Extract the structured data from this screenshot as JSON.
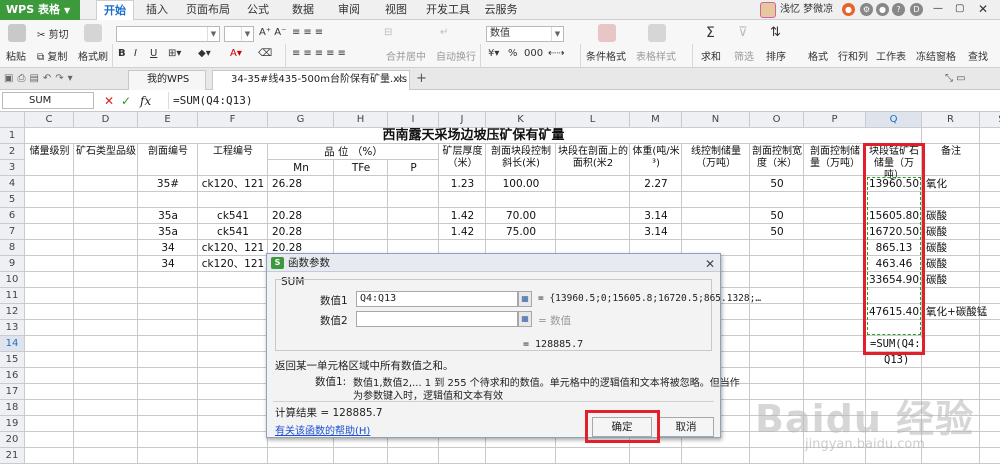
{
  "app": {
    "name": "WPS 表格"
  },
  "menu": {
    "tabs": [
      "开始",
      "插入",
      "页面布局",
      "公式",
      "数据",
      "审阅",
      "视图",
      "开发工具",
      "云服务"
    ],
    "active": "开始"
  },
  "user": {
    "name": "浅忆 梦微凉"
  },
  "ribbon": {
    "cut": "剪切",
    "paste": "粘贴",
    "copy": "复制",
    "format_painter": "格式刷",
    "merge_center": "合并居中",
    "auto_wrap": "自动换行",
    "number_format": "数值",
    "cond_format": "条件格式",
    "table_style": "表格样式",
    "sum": "求和",
    "filter": "筛选",
    "sort": "排序",
    "format": "格式",
    "rowcol": "行和列",
    "sheet": "工作表",
    "freeze": "冻结窗格",
    "find": "查找",
    "percent": "%",
    "thousand": "000"
  },
  "doc_tabs": {
    "home": "我的WPS",
    "file": "34-35#线435-500m台阶保有矿量.xls"
  },
  "formula_bar": {
    "name_box": "SUM",
    "formula": "=SUM(Q4:Q13)"
  },
  "title": "西南露天采场边坡压矿保有矿量",
  "columns": [
    "C",
    "D",
    "E",
    "F",
    "G",
    "H",
    "I",
    "J",
    "K",
    "L",
    "M",
    "N",
    "O",
    "P",
    "Q",
    "R",
    "S"
  ],
  "rows": [
    "1",
    "2",
    "3",
    "4",
    "5",
    "6",
    "7",
    "8",
    "9",
    "10",
    "11",
    "12",
    "13",
    "14",
    "15",
    "16",
    "17",
    "18",
    "19",
    "20",
    "21"
  ],
  "headers": {
    "reserve_level": "储量级别",
    "ore_type": "矿石类型品级",
    "section_no": "剖面编号",
    "project_no": "工程编号",
    "grade": "品 位 （%）",
    "mn": "Mn",
    "tfe": "TFe",
    "p": "P",
    "thickness": "矿层厚度（米）",
    "control_len": "剖面块段控制斜长(米)",
    "area": "块段在剖面上的面积(米2",
    "density": "体重(吨/米³)",
    "line_reserve": "线控制储量（万吨）",
    "section_width": "剖面控制宽度（米）",
    "section_reserve": "剖面控制储量（万吨）",
    "block_reserve": "块段锰矿石储量（万吨）",
    "remark": "备注"
  },
  "data_rows": [
    {
      "row": "4",
      "e": "35#",
      "f": "ck120、121",
      "g": "26.28",
      "j": "1.23",
      "k": "100.00",
      "m": "2.27",
      "o": "50",
      "q": "13960.50",
      "r": "氧化"
    },
    {
      "row": "5",
      "e": "",
      "f": "",
      "g": "",
      "j": "",
      "k": "",
      "m": "",
      "o": "",
      "q": "",
      "r": ""
    },
    {
      "row": "6",
      "e": "35a",
      "f": "ck541",
      "g": "20.28",
      "j": "1.42",
      "k": "70.00",
      "m": "3.14",
      "o": "50",
      "q": "15605.80",
      "r": "碳酸"
    },
    {
      "row": "7",
      "e": "35a",
      "f": "ck541",
      "g": "20.28",
      "j": "1.42",
      "k": "75.00",
      "m": "3.14",
      "o": "50",
      "q": "16720.50",
      "r": "碳酸"
    },
    {
      "row": "8",
      "e": "34",
      "f": "ck120、121",
      "g": "20.28",
      "j": "",
      "k": "",
      "m": "",
      "o": "",
      "q": "865.13",
      "r": "碳酸"
    },
    {
      "row": "9",
      "e": "34",
      "f": "ck120、121",
      "g": "20.28",
      "j": "",
      "k": "",
      "m": "",
      "o": "",
      "q": "463.46",
      "r": "碳酸"
    },
    {
      "row": "10",
      "e": "",
      "f": "",
      "g": "",
      "j": "",
      "k": "",
      "m": "",
      "o": "",
      "q": "33654.90",
      "r": "碳酸"
    },
    {
      "row": "11",
      "e": "",
      "f": "",
      "g": "",
      "j": "",
      "k": "",
      "m": "",
      "o": "",
      "q": "",
      "r": ""
    },
    {
      "row": "12",
      "e": "",
      "f": "",
      "g": "",
      "j": "",
      "k": "",
      "m": "",
      "o": "",
      "q": "47615.40",
      "r": "氧化+碳酸锰"
    },
    {
      "row": "13",
      "e": "",
      "f": "",
      "g": "",
      "j": "",
      "k": "",
      "m": "",
      "o": "",
      "q": "",
      "r": ""
    }
  ],
  "edit_cell": {
    "line1": "=SUM(Q4:",
    "line2": "Q13)"
  },
  "dialog": {
    "title": "函数参数",
    "func_name": "SUM",
    "arg1_label": "数值1",
    "arg1_value": "Q4:Q13",
    "arg1_result": "= {13960.5;0;15605.8;16720.5;865.1328;…",
    "arg2_label": "数值2",
    "arg2_result": "= 数值",
    "inline_result": "= 128885.7",
    "description": "返回某一单元格区域中所有数值之和。",
    "arg_desc_label": "数值1:",
    "arg_desc_line1": "数值1,数值2,... 1 到 255 个待求和的数值。单元格中的逻辑值和文本将被忽略。但当作",
    "arg_desc_line2": "为参数键入时，逻辑值和文本有效",
    "calc_result": "计算结果 = 128885.7",
    "help_link": "有关该函数的帮助(H)",
    "ok": "确定",
    "cancel": "取消"
  },
  "watermark": {
    "brand": "Baidu 经验",
    "url": "jingyan.baidu.com"
  },
  "colors": {
    "accent": "#3c9a3c",
    "highlight": "#e21f2a",
    "marquee": "#2aa12a",
    "link": "#1b4fd6"
  }
}
